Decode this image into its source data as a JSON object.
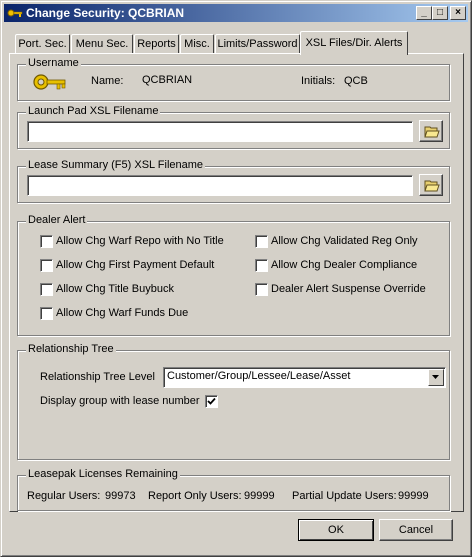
{
  "window": {
    "title": "Change Security: QCBRIAN"
  },
  "titlebar_buttons": {
    "minimize": "_",
    "maximize": "□",
    "close": "×"
  },
  "tabs": [
    {
      "label": "Port. Sec."
    },
    {
      "label": "Menu Sec."
    },
    {
      "label": "Reports"
    },
    {
      "label": "Misc."
    },
    {
      "label": "Limits/Password"
    },
    {
      "label": "XSL Files/Dir. Alerts",
      "active": true
    }
  ],
  "username": {
    "group_label": "Username",
    "name_label": "Name:",
    "name_value": "QCBRIAN",
    "initials_label": "Initials:",
    "initials_value": "QCB",
    "icon": "key-icon"
  },
  "launch_pad": {
    "group_label": "Launch Pad XSL Filename",
    "value": "",
    "icon": "folder-open-icon"
  },
  "lease_summary": {
    "group_label": "Lease Summary (F5) XSL Filename",
    "value": "",
    "icon": "folder-open-icon"
  },
  "dealer_alert": {
    "group_label": "Dealer Alert",
    "left": [
      {
        "label": "Allow Chg Warf Repo with No Title",
        "checked": false
      },
      {
        "label": "Allow Chg First Payment Default",
        "checked": false
      },
      {
        "label": "Allow Chg Title Buybuck",
        "checked": false
      },
      {
        "label": "Allow Chg Warf Funds Due",
        "checked": false
      }
    ],
    "right": [
      {
        "label": "Allow Chg Validated Reg Only",
        "checked": false
      },
      {
        "label": "Allow Chg Dealer Compliance",
        "checked": false
      },
      {
        "label": "Dealer Alert Suspense Override",
        "checked": false
      }
    ]
  },
  "relationship_tree": {
    "group_label": "Relationship Tree",
    "level_label": "Relationship Tree Level",
    "level_value": "Customer/Group/Lessee/Lease/Asset",
    "display_label": "Display group with lease number",
    "display_checked": true
  },
  "licenses": {
    "group_label": "Leasepak Licenses Remaining",
    "regular_label": "Regular Users:",
    "regular_value": "99973",
    "report_label": "Report Only Users:",
    "report_value": "99999",
    "partial_label": "Partial Update Users:",
    "partial_value": "99999"
  },
  "buttons": {
    "ok": "OK",
    "cancel": "Cancel"
  }
}
